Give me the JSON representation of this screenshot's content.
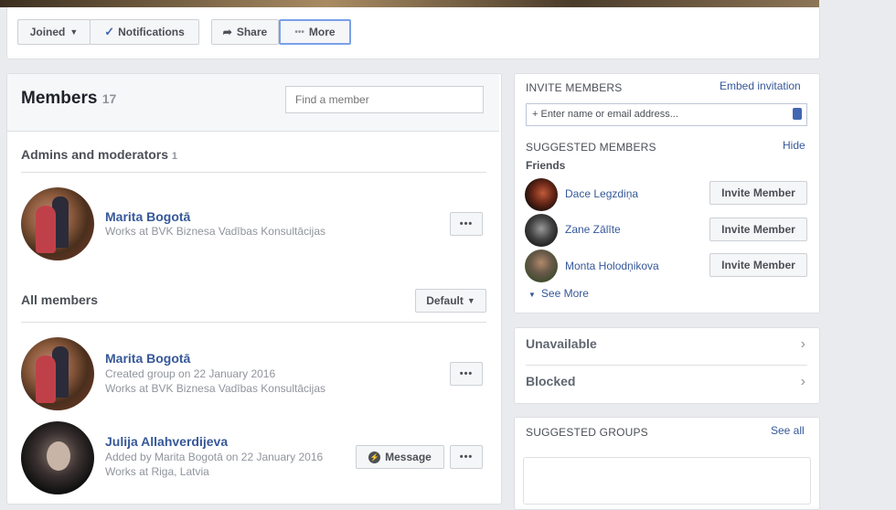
{
  "cover": {
    "colors": [
      "#2b2319",
      "#a88b62",
      "#6e5a43"
    ]
  },
  "actionbar": {
    "joined_label": "Joined",
    "notifications_label": "Notifications",
    "share_label": "Share",
    "more_label": "More"
  },
  "members": {
    "title": "Members",
    "count": "17",
    "find_placeholder": "Find a member",
    "admins_label": "Admins and moderators",
    "admins_count": "1",
    "admin": {
      "name": "Marita Bogotā",
      "detail": "Works at BVK Biznesa Vadības Konsultācijas"
    },
    "all_label": "All members",
    "sort_label": "Default",
    "list": [
      {
        "name": "Marita Bogotā",
        "line1": "Created group on 22 January 2016",
        "line2": "Works at BVK Biznesa Vadības Konsultācijas"
      },
      {
        "name": "Julija Allahverdijeva",
        "line1": "Added by Marita Bogotā on 22 January 2016",
        "line2": "Works at Riga, Latvia",
        "message_label": "Message"
      }
    ],
    "more_glyph": "•••"
  },
  "invite": {
    "title": "INVITE MEMBERS",
    "embed_label": "Embed invitation",
    "input_placeholder": "+ Enter name or email address...",
    "suggested_title": "SUGGESTED MEMBERS",
    "hide_label": "Hide",
    "friends_label": "Friends",
    "friends": [
      {
        "name": "Dace Legzdiņa",
        "button": "Invite Member"
      },
      {
        "name": "Zane Zālīte",
        "button": "Invite Member"
      },
      {
        "name": "Monta Holodņikova",
        "button": "Invite Member"
      }
    ],
    "see_more_label": "See More"
  },
  "privacy": {
    "unavailable_label": "Unavailable",
    "blocked_label": "Blocked"
  },
  "groups": {
    "title": "SUGGESTED GROUPS",
    "see_all_label": "See all"
  }
}
